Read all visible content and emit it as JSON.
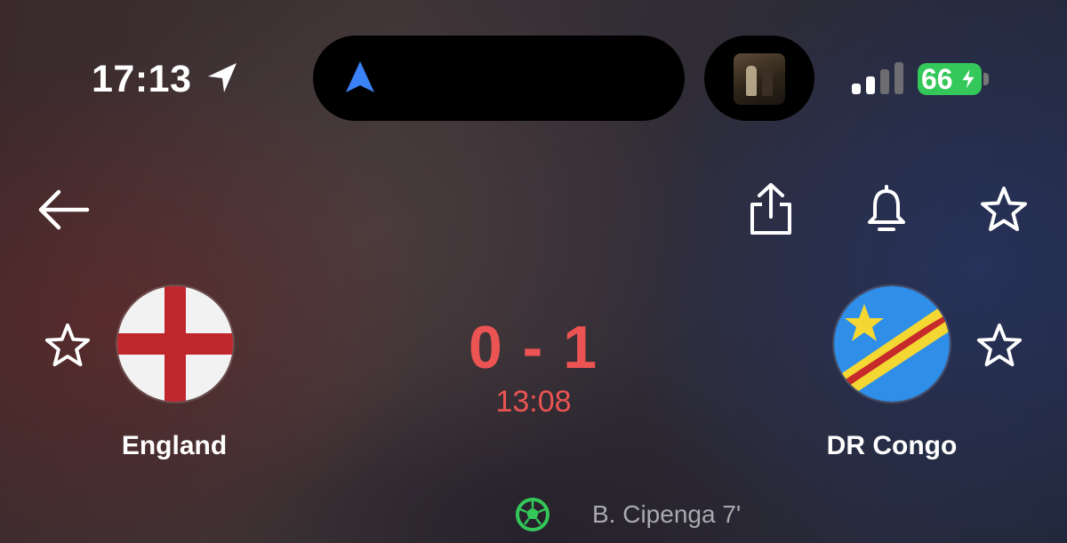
{
  "status_bar": {
    "time": "17:13",
    "battery_level": "66",
    "icons": [
      "location-arrow-icon",
      "navigation-arrow-icon",
      "album-art",
      "cellular-signal-icon",
      "battery-charging-icon"
    ]
  },
  "header": {
    "icons": [
      "back-arrow-icon",
      "share-icon",
      "bell-icon",
      "star-icon"
    ]
  },
  "match": {
    "home_team": "England",
    "away_team": "DR Congo",
    "score": "0 - 1",
    "clock": "13:08",
    "events": [
      {
        "icon": "football-icon",
        "text": "B. Cipenga 7'"
      }
    ]
  },
  "colors": {
    "score": "#ec5353",
    "battery": "#34c759",
    "nav_arrow": "#3b82f6",
    "event_text": "#a9a9ae",
    "goal_icon": "#34c759"
  }
}
